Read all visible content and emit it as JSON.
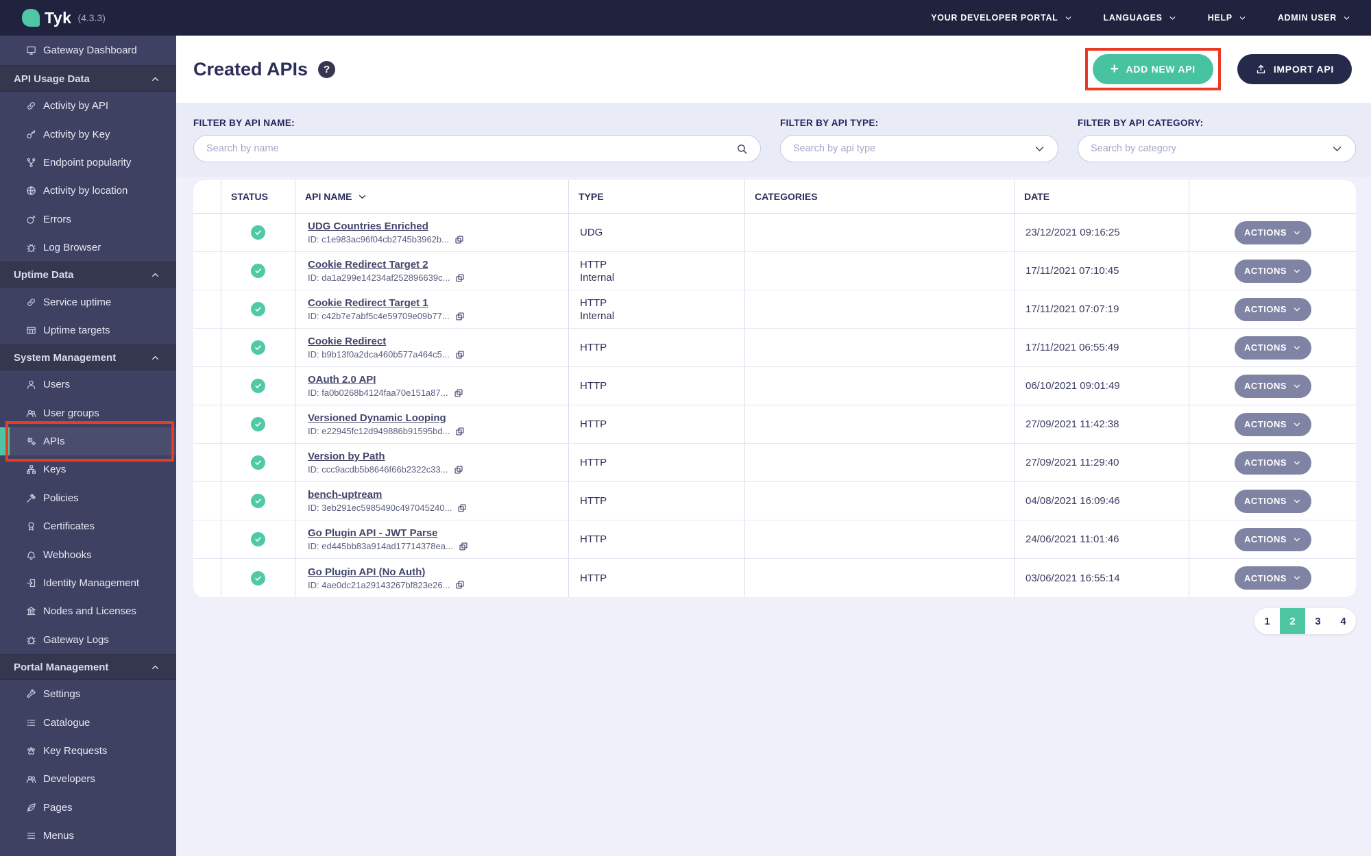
{
  "topbar": {
    "brand": "Tyk",
    "version": "(4.3.3)",
    "menu": [
      {
        "label": "YOUR DEVELOPER PORTAL"
      },
      {
        "label": "LANGUAGES"
      },
      {
        "label": "HELP"
      },
      {
        "label": "ADMIN USER"
      }
    ]
  },
  "sidebar": {
    "top_item": {
      "label": "Gateway Dashboard",
      "icon": "monitor-icon"
    },
    "sections": [
      {
        "label": "API Usage Data",
        "items": [
          {
            "label": "Activity by API",
            "icon": "link-icon"
          },
          {
            "label": "Activity by Key",
            "icon": "key-icon"
          },
          {
            "label": "Endpoint popularity",
            "icon": "branch-icon"
          },
          {
            "label": "Activity by location",
            "icon": "globe-icon"
          },
          {
            "label": "Errors",
            "icon": "bomb-icon"
          },
          {
            "label": "Log Browser",
            "icon": "bug-icon"
          }
        ]
      },
      {
        "label": "Uptime Data",
        "items": [
          {
            "label": "Service uptime",
            "icon": "link-icon"
          },
          {
            "label": "Uptime targets",
            "icon": "table-icon"
          }
        ]
      },
      {
        "label": "System Management",
        "items": [
          {
            "label": "Users",
            "icon": "user-icon"
          },
          {
            "label": "User groups",
            "icon": "users-icon"
          },
          {
            "label": "APIs",
            "icon": "gears-icon",
            "active": true,
            "annotated": true
          },
          {
            "label": "Keys",
            "icon": "sitemap-icon"
          },
          {
            "label": "Policies",
            "icon": "gavel-icon"
          },
          {
            "label": "Certificates",
            "icon": "certificate-icon"
          },
          {
            "label": "Webhooks",
            "icon": "bell-icon"
          },
          {
            "label": "Identity Management",
            "icon": "sign-in-icon"
          },
          {
            "label": "Nodes and Licenses",
            "icon": "bank-icon"
          },
          {
            "label": "Gateway Logs",
            "icon": "bug-icon"
          }
        ]
      },
      {
        "label": "Portal Management",
        "items": [
          {
            "label": "Settings",
            "icon": "wrench-icon"
          },
          {
            "label": "Catalogue",
            "icon": "list-icon"
          },
          {
            "label": "Key Requests",
            "icon": "paw-icon"
          },
          {
            "label": "Developers",
            "icon": "users-icon"
          },
          {
            "label": "Pages",
            "icon": "leaf-icon"
          },
          {
            "label": "Menus",
            "icon": "menu-icon"
          }
        ]
      }
    ]
  },
  "header": {
    "title": "Created APIs",
    "help_text": "?",
    "add_button": "ADD NEW API",
    "import_button": "IMPORT API"
  },
  "filters": [
    {
      "label": "FILTER BY API NAME:",
      "placeholder": "Search by name"
    },
    {
      "label": "FILTER BY API TYPE:",
      "placeholder": "Search by api type"
    },
    {
      "label": "FILTER BY API CATEGORY:",
      "placeholder": "Search by category"
    }
  ],
  "table": {
    "columns": [
      "STATUS",
      "API NAME",
      "TYPE",
      "CATEGORIES",
      "DATE"
    ],
    "actions_label": "ACTIONS",
    "rows": [
      {
        "name": "UDG Countries Enriched",
        "id": "ID: c1e983ac96f04cb2745b3962b...",
        "type": [
          "UDG"
        ],
        "categories": "",
        "date": "23/12/2021 09:16:25"
      },
      {
        "name": "Cookie Redirect Target 2",
        "id": "ID: da1a299e14234af252896639c...",
        "type": [
          "HTTP",
          "Internal"
        ],
        "categories": "",
        "date": "17/11/2021 07:10:45"
      },
      {
        "name": "Cookie Redirect Target 1",
        "id": "ID: c42b7e7abf5c4e59709e09b77...",
        "type": [
          "HTTP",
          "Internal"
        ],
        "categories": "",
        "date": "17/11/2021 07:07:19"
      },
      {
        "name": "Cookie Redirect",
        "id": "ID: b9b13f0a2dca460b577a464c5...",
        "type": [
          "HTTP"
        ],
        "categories": "",
        "date": "17/11/2021 06:55:49"
      },
      {
        "name": "OAuth 2.0 API",
        "id": "ID: fa0b0268b4124faa70e151a87...",
        "type": [
          "HTTP"
        ],
        "categories": "",
        "date": "06/10/2021 09:01:49"
      },
      {
        "name": "Versioned Dynamic Looping",
        "id": "ID: e22945fc12d949886b91595bd...",
        "type": [
          "HTTP"
        ],
        "categories": "",
        "date": "27/09/2021 11:42:38"
      },
      {
        "name": "Version by Path",
        "id": "ID: ccc9acdb5b8646f66b2322c33...",
        "type": [
          "HTTP"
        ],
        "categories": "",
        "date": "27/09/2021 11:29:40"
      },
      {
        "name": "bench-uptream",
        "id": "ID: 3eb291ec5985490c497045240...",
        "type": [
          "HTTP"
        ],
        "categories": "",
        "date": "04/08/2021 16:09:46"
      },
      {
        "name": "Go Plugin API - JWT Parse",
        "id": "ID: ed445bb83a914ad17714378ea...",
        "type": [
          "HTTP"
        ],
        "categories": "",
        "date": "24/06/2021 11:01:46"
      },
      {
        "name": "Go Plugin API (No Auth)",
        "id": "ID: 4ae0dc21a29143267bf823e26...",
        "type": [
          "HTTP"
        ],
        "categories": "",
        "date": "03/06/2021 16:55:14"
      }
    ]
  },
  "pagination": {
    "pages": [
      "1",
      "2",
      "3",
      "4"
    ],
    "active": "2"
  },
  "colors": {
    "accent_teal": "#48C3A2",
    "annotation_red": "#EA3A21",
    "topbar_navy": "#20223E",
    "sidebar_bg": "#3E4161",
    "actions_gray": "#7F83A4",
    "status_ok_green": "#4FC9A6"
  }
}
